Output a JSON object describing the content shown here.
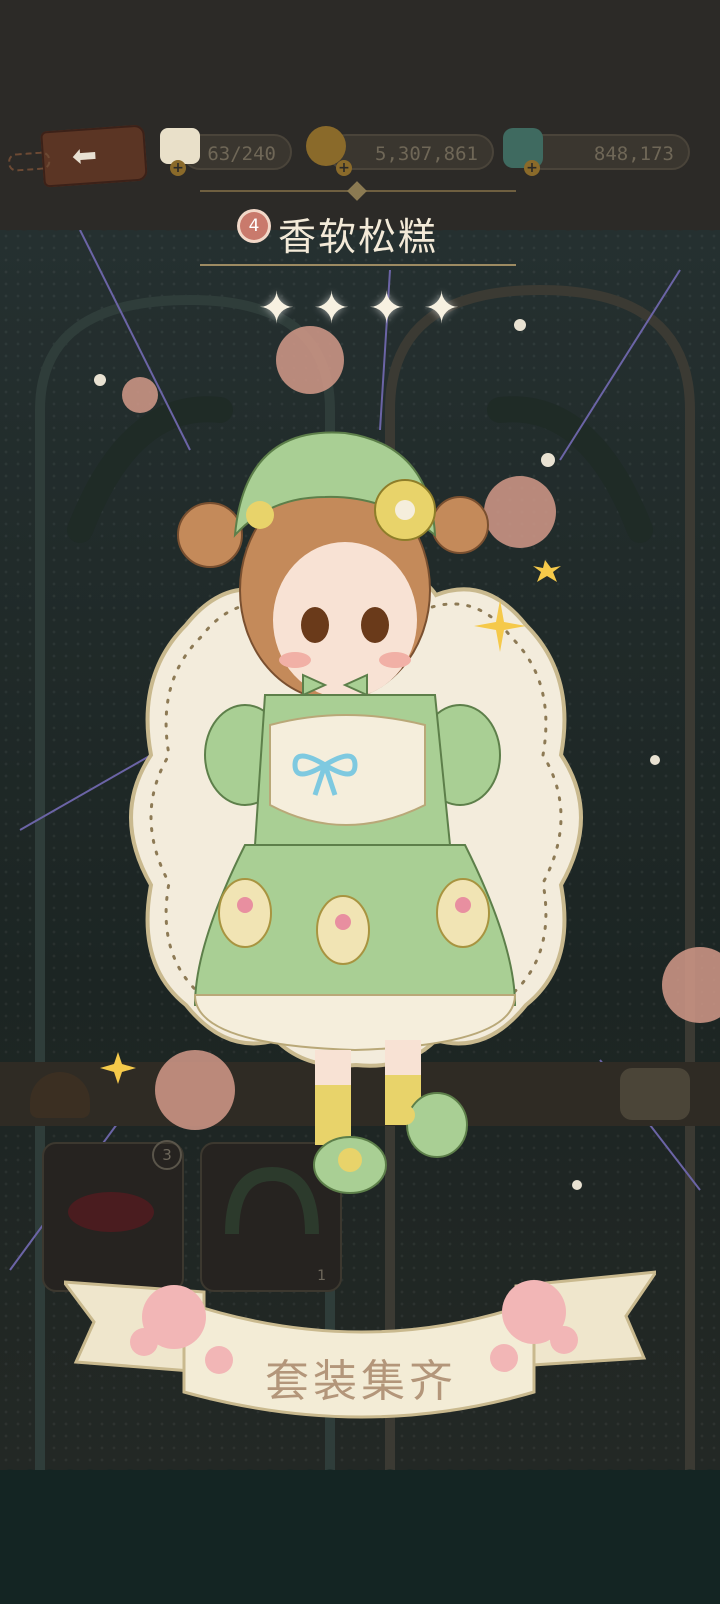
{
  "resources": {
    "stamina": {
      "value": "63/240",
      "icon": "cake-icon"
    },
    "coins": {
      "value": "5,307,861",
      "icon": "coin-icon"
    },
    "gems": {
      "value": "848,173",
      "icon": "gem-icon"
    }
  },
  "outfit": {
    "level": "4",
    "name": "香软松糕",
    "stars": 4
  },
  "tray": {
    "slot_count_badge": "3",
    "slot_count": "1"
  },
  "completion_banner": "套装集齐",
  "colors": {
    "dress_green": "#a9cf94",
    "apron": "#f5eedc",
    "hair": "#c48a5a",
    "bow_blue": "#7ec9e0",
    "flower_yellow": "#e8d36a",
    "banner": "#f1e9d2"
  }
}
